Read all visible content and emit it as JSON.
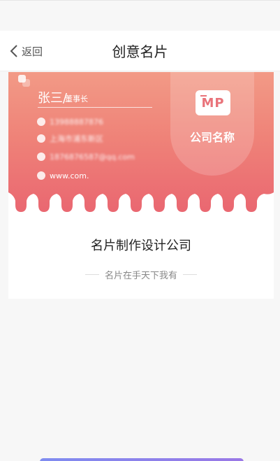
{
  "header": {
    "back_label": "返回",
    "title": "创意名片"
  },
  "card": {
    "person_name": "张三/",
    "person_title": "董事长",
    "phone": "13988887876",
    "address": "上海市浦东新区",
    "email": "1876876587@qq.com",
    "website": "www.com.",
    "logo_text": "MP",
    "company_label": "公司名称"
  },
  "company": {
    "name": "名片制作设计公司",
    "slogan": "名片在手天下我有"
  },
  "colors": {
    "card_top": "#f29a86",
    "card_bottom": "#e96470",
    "button_start": "#7f8cf0",
    "button_end": "#9a78e6"
  }
}
